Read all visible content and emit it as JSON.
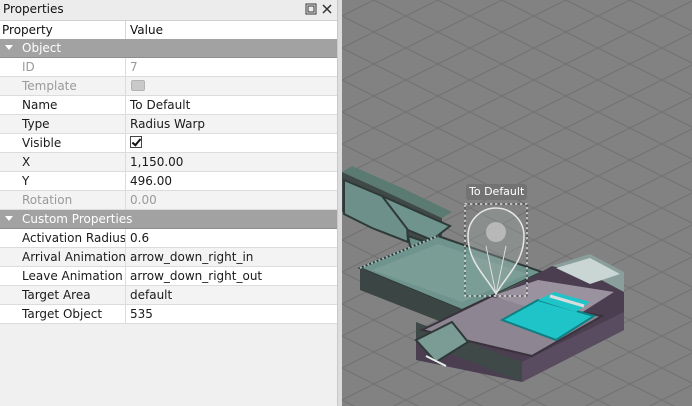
{
  "panel": {
    "title": "Properties",
    "header": {
      "property": "Property",
      "value": "Value"
    }
  },
  "groups": {
    "object": {
      "label": "Object",
      "rows": [
        {
          "key": "ID",
          "value": "7"
        },
        {
          "key": "Template",
          "value": ""
        },
        {
          "key": "Name",
          "value": "To Default"
        },
        {
          "key": "Type",
          "value": "Radius Warp"
        },
        {
          "key": "Visible",
          "value": ""
        },
        {
          "key": "X",
          "value": "1,150.00"
        },
        {
          "key": "Y",
          "value": "496.00"
        },
        {
          "key": "Rotation",
          "value": "0.00"
        }
      ]
    },
    "custom": {
      "label": "Custom Properties",
      "rows": [
        {
          "key": "Activation Radius",
          "value": "0.6"
        },
        {
          "key": "Arrival Animation",
          "value": "arrow_down_right_in"
        },
        {
          "key": "Leave Animation",
          "value": "arrow_down_right_out"
        },
        {
          "key": "Target Area",
          "value": "default"
        },
        {
          "key": "Target Object",
          "value": "535"
        }
      ]
    }
  },
  "map": {
    "object_label": "To Default",
    "colors": {
      "background": "#828282",
      "grid": "#6f6f6f",
      "tile": "#6a8f86",
      "pool": "#1fc4c8"
    }
  }
}
